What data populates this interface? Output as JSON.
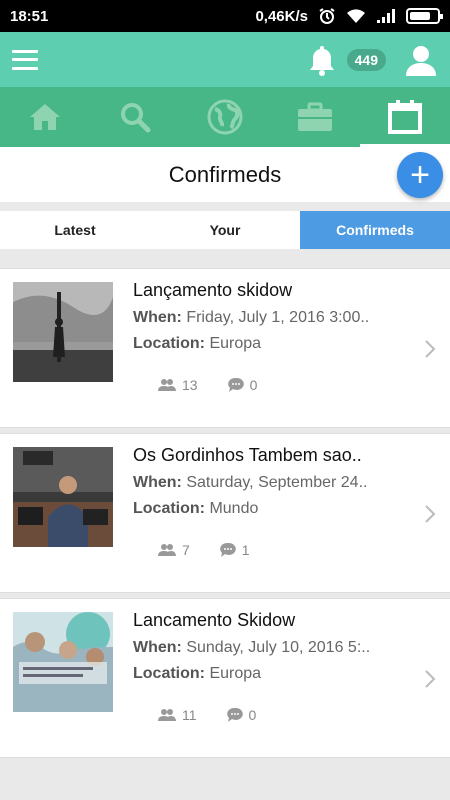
{
  "statusbar": {
    "time": "18:51",
    "speed": "0,46K/s"
  },
  "header": {
    "notification_count": "449"
  },
  "nav": {
    "items": [
      {
        "icon": "home-icon"
      },
      {
        "icon": "search-icon"
      },
      {
        "icon": "globe-icon"
      },
      {
        "icon": "briefcase-icon"
      },
      {
        "icon": "calendar-icon",
        "active": true
      }
    ]
  },
  "page": {
    "title": "Confirmeds",
    "add_label": "+"
  },
  "tabs": [
    {
      "label": "Latest"
    },
    {
      "label": "Your"
    },
    {
      "label": "Confirmeds",
      "active": true
    }
  ],
  "labels": {
    "when": "When:",
    "location": "Location:"
  },
  "events": [
    {
      "title": "Lançamento skidow",
      "when": "Friday, July 1, 2016 3:00..",
      "location": "Europa",
      "attendees": "13",
      "comments": "0"
    },
    {
      "title": "Os Gordinhos Tambem sao..",
      "when": "Saturday, September 24..",
      "location": "Mundo",
      "attendees": "7",
      "comments": "1"
    },
    {
      "title": "Lancamento Skidow",
      "when": "Sunday, July 10, 2016 5:..",
      "location": "Europa",
      "attendees": "11",
      "comments": "0"
    }
  ],
  "colors": {
    "topbar": "#5dcfb0",
    "navbar": "#47b788",
    "accent": "#4d9be3",
    "fab": "#3a8ee6"
  }
}
